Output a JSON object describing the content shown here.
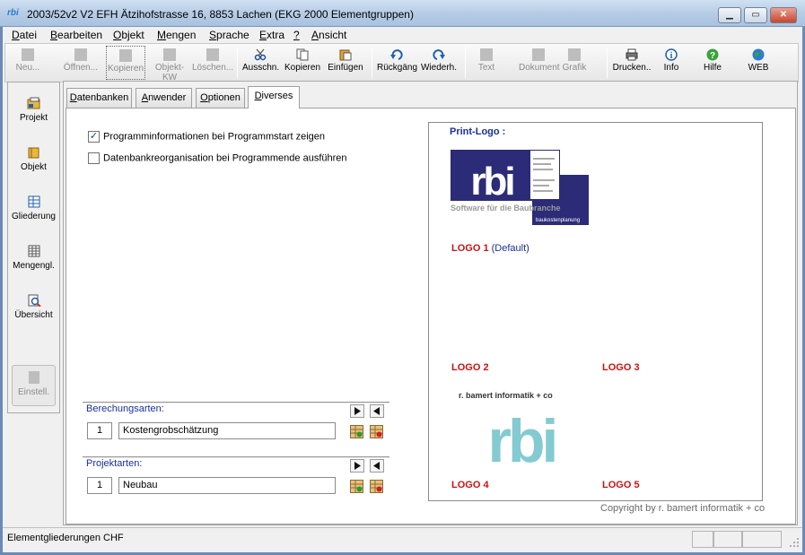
{
  "window": {
    "icon": "rbi",
    "title": "2003/52v2 V2 EFH Ätzihofstrasse 16, 8853 Lachen (EKG 2000 Elementgruppen)",
    "minimize_icon": "minimize-icon",
    "maximize_icon": "maximize-icon",
    "close_icon": "close-icon"
  },
  "menu": {
    "items": [
      {
        "acc": "D",
        "rest": "atei"
      },
      {
        "acc": "B",
        "rest": "earbeiten"
      },
      {
        "acc": "O",
        "rest": "bjekt"
      },
      {
        "acc": "M",
        "rest": "engen"
      },
      {
        "acc": "S",
        "rest": "prache"
      },
      {
        "acc": "E",
        "rest": "xtra"
      },
      {
        "acc": "?",
        "rest": ""
      },
      {
        "acc": "A",
        "rest": "nsicht"
      }
    ]
  },
  "toolbar": {
    "buttons": [
      {
        "label": "Neu...",
        "icon": "new-doc-icon",
        "enabled": false
      },
      {
        "label": "Öffnen...",
        "icon": "open-folder-icon",
        "enabled": false
      },
      {
        "label": "Kopieren",
        "icon": "copy-project-icon",
        "enabled": false
      },
      {
        "label": "Objekt-KW",
        "icon": "puzzle-icon",
        "enabled": false
      },
      {
        "label": "Löschen...",
        "icon": "delete-x-icon",
        "enabled": false
      },
      {
        "label": "Ausschn.",
        "icon": "scissors-icon",
        "enabled": true
      },
      {
        "label": "Kopieren",
        "icon": "copy-icon",
        "enabled": true
      },
      {
        "label": "Einfügen",
        "icon": "paste-icon",
        "enabled": true
      },
      {
        "label": "Rückgäng",
        "icon": "undo-icon",
        "enabled": true
      },
      {
        "label": "Wiederh.",
        "icon": "redo-icon",
        "enabled": true
      },
      {
        "label": "Text",
        "icon": "text-doc-icon",
        "enabled": false
      },
      {
        "label": "Dokument",
        "icon": "document-icon",
        "enabled": false
      },
      {
        "label": "Grafik",
        "icon": "graphic-icon",
        "enabled": false
      },
      {
        "label": "Drucken..",
        "icon": "printer-icon",
        "enabled": true
      },
      {
        "label": "Info",
        "icon": "info-icon",
        "enabled": true
      },
      {
        "label": "Hilfe",
        "icon": "help-icon",
        "enabled": true
      },
      {
        "label": "WEB",
        "icon": "globe-icon",
        "enabled": true
      }
    ]
  },
  "sidebar": {
    "items": [
      {
        "label": "Projekt",
        "icon": "project-icon",
        "enabled": true
      },
      {
        "label": "Objekt",
        "icon": "object-icon",
        "enabled": true
      },
      {
        "label": "Gliederung",
        "icon": "structure-icon",
        "enabled": true
      },
      {
        "label": "Mengengl.",
        "icon": "quantity-grid-icon",
        "enabled": true
      },
      {
        "label": "Übersicht",
        "icon": "overview-icon",
        "enabled": true
      },
      {
        "label": "Einstell.",
        "icon": "settings-icon",
        "enabled": false
      }
    ]
  },
  "tabs": [
    {
      "acc": "D",
      "rest": "atenbanken",
      "active": false
    },
    {
      "acc": "A",
      "rest": "nwender",
      "active": false
    },
    {
      "acc": "O",
      "rest": "ptionen",
      "active": false
    },
    {
      "acc": "D",
      "rest": "iverses",
      "active": true
    }
  ],
  "options": {
    "show_info": {
      "label": "Programminformationen bei Programmstart zeigen",
      "checked": true
    },
    "db_reorg": {
      "label": "Datenbankreorganisation bei Programmende ausführen",
      "checked": false
    }
  },
  "berechnungsarten": {
    "title": "Berechungsarten:",
    "number": "1",
    "value": "Kostengrobschätzung"
  },
  "projektarten": {
    "title": "Projektarten:",
    "number": "1",
    "value": "Neubau"
  },
  "logos": {
    "print_logo_label": "Print-Logo :",
    "logo1": "LOGO 1",
    "logo1_default": "(Default)",
    "logo2": "LOGO 2",
    "logo3": "LOGO 3",
    "logo4": "LOGO 4",
    "logo5": "LOGO 5",
    "print_logo_subtitle": "Software für die Baubranche",
    "print_logo_fine": "baukostenplanung",
    "logo4_caption": "r. bamert informatik + co",
    "logo_mark": "rbi",
    "brand_color": "#2b2b78",
    "logo4_color": "#6ec3c9"
  },
  "copyright": "Copyright by r. bamert informatik + co",
  "status": {
    "text": "Elementgliederungen CHF"
  }
}
